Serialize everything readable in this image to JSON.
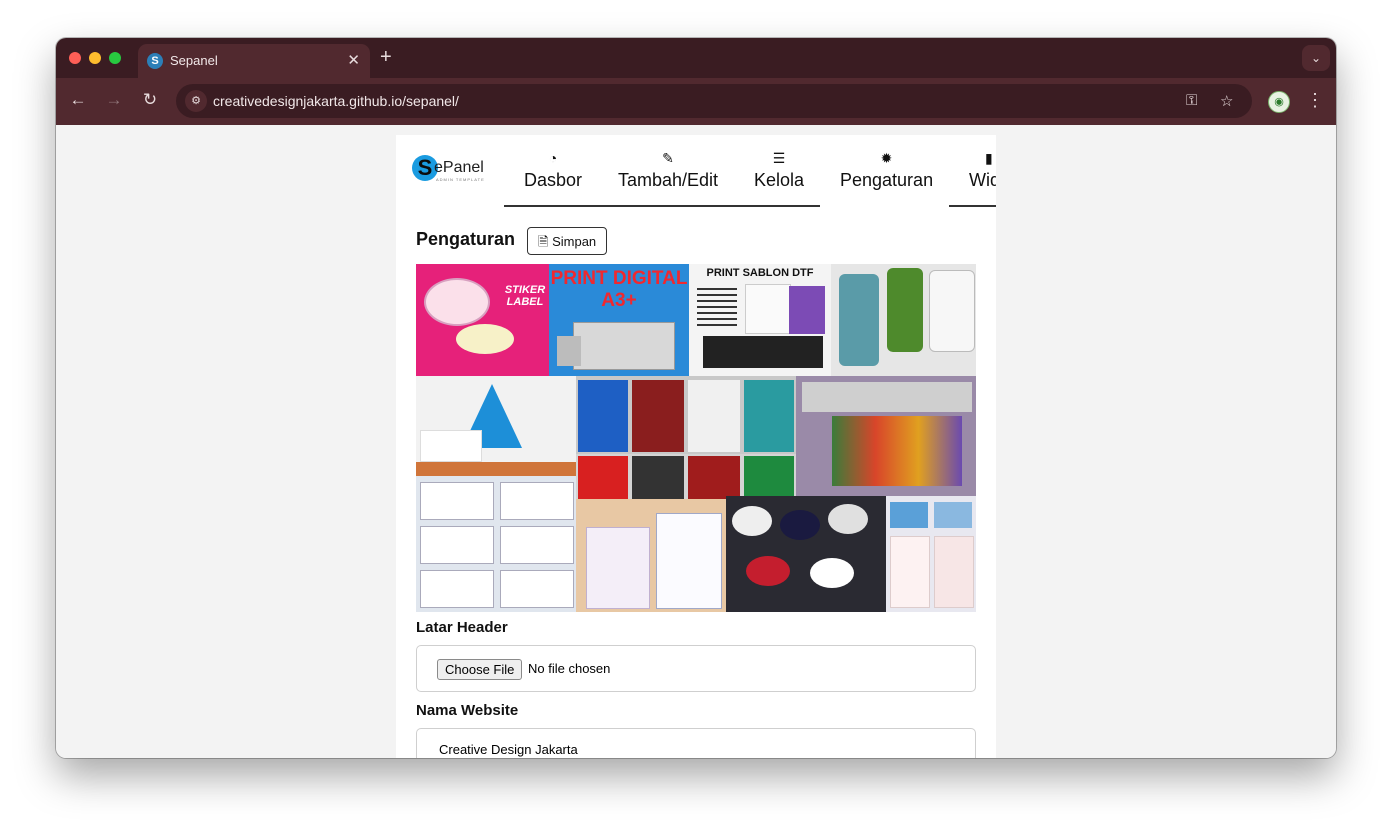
{
  "browser": {
    "tab_title": "Sepanel",
    "tab_close": "✕",
    "new_tab": "+",
    "tab_menu": "⌄",
    "url": "creativedesignjakarta.github.io/sepanel/",
    "back": "←",
    "forward": "→",
    "reload": "↻",
    "site_info": "⚙",
    "key_icon": "⚿",
    "star_icon": "☆",
    "menu_icon": "⋮"
  },
  "logo": {
    "text": "ePanel",
    "letter": "S",
    "subtitle": "ADMIN TEMPLATE"
  },
  "nav": {
    "items": [
      {
        "icon": "◔",
        "label": "Dasbor"
      },
      {
        "icon": "✎",
        "label": "Tambah/Edit"
      },
      {
        "icon": "☰",
        "label": "Kelola"
      },
      {
        "icon": "✹",
        "label": "Pengaturan"
      },
      {
        "icon": "▮",
        "label": "Widget"
      }
    ]
  },
  "page": {
    "heading": "Pengaturan",
    "save_label": "Simpan",
    "save_icon": "🗎"
  },
  "collage": {
    "tiles": [
      {
        "text": "STIKER LABEL",
        "color": "#e6217a"
      },
      {
        "text": "PRINT DIGITAL A3+",
        "color": "#2a8ad8"
      },
      {
        "text": "PRINT SABLON DTF",
        "color": "#f4f4f4"
      },
      {
        "text": "",
        "color": "#7a9a8a"
      }
    ]
  },
  "form": {
    "header_label": "Latar Header",
    "file_button": "Choose File",
    "file_status": "No file chosen",
    "site_name_label": "Nama Website",
    "site_name_value": "Creative Design Jakarta"
  }
}
